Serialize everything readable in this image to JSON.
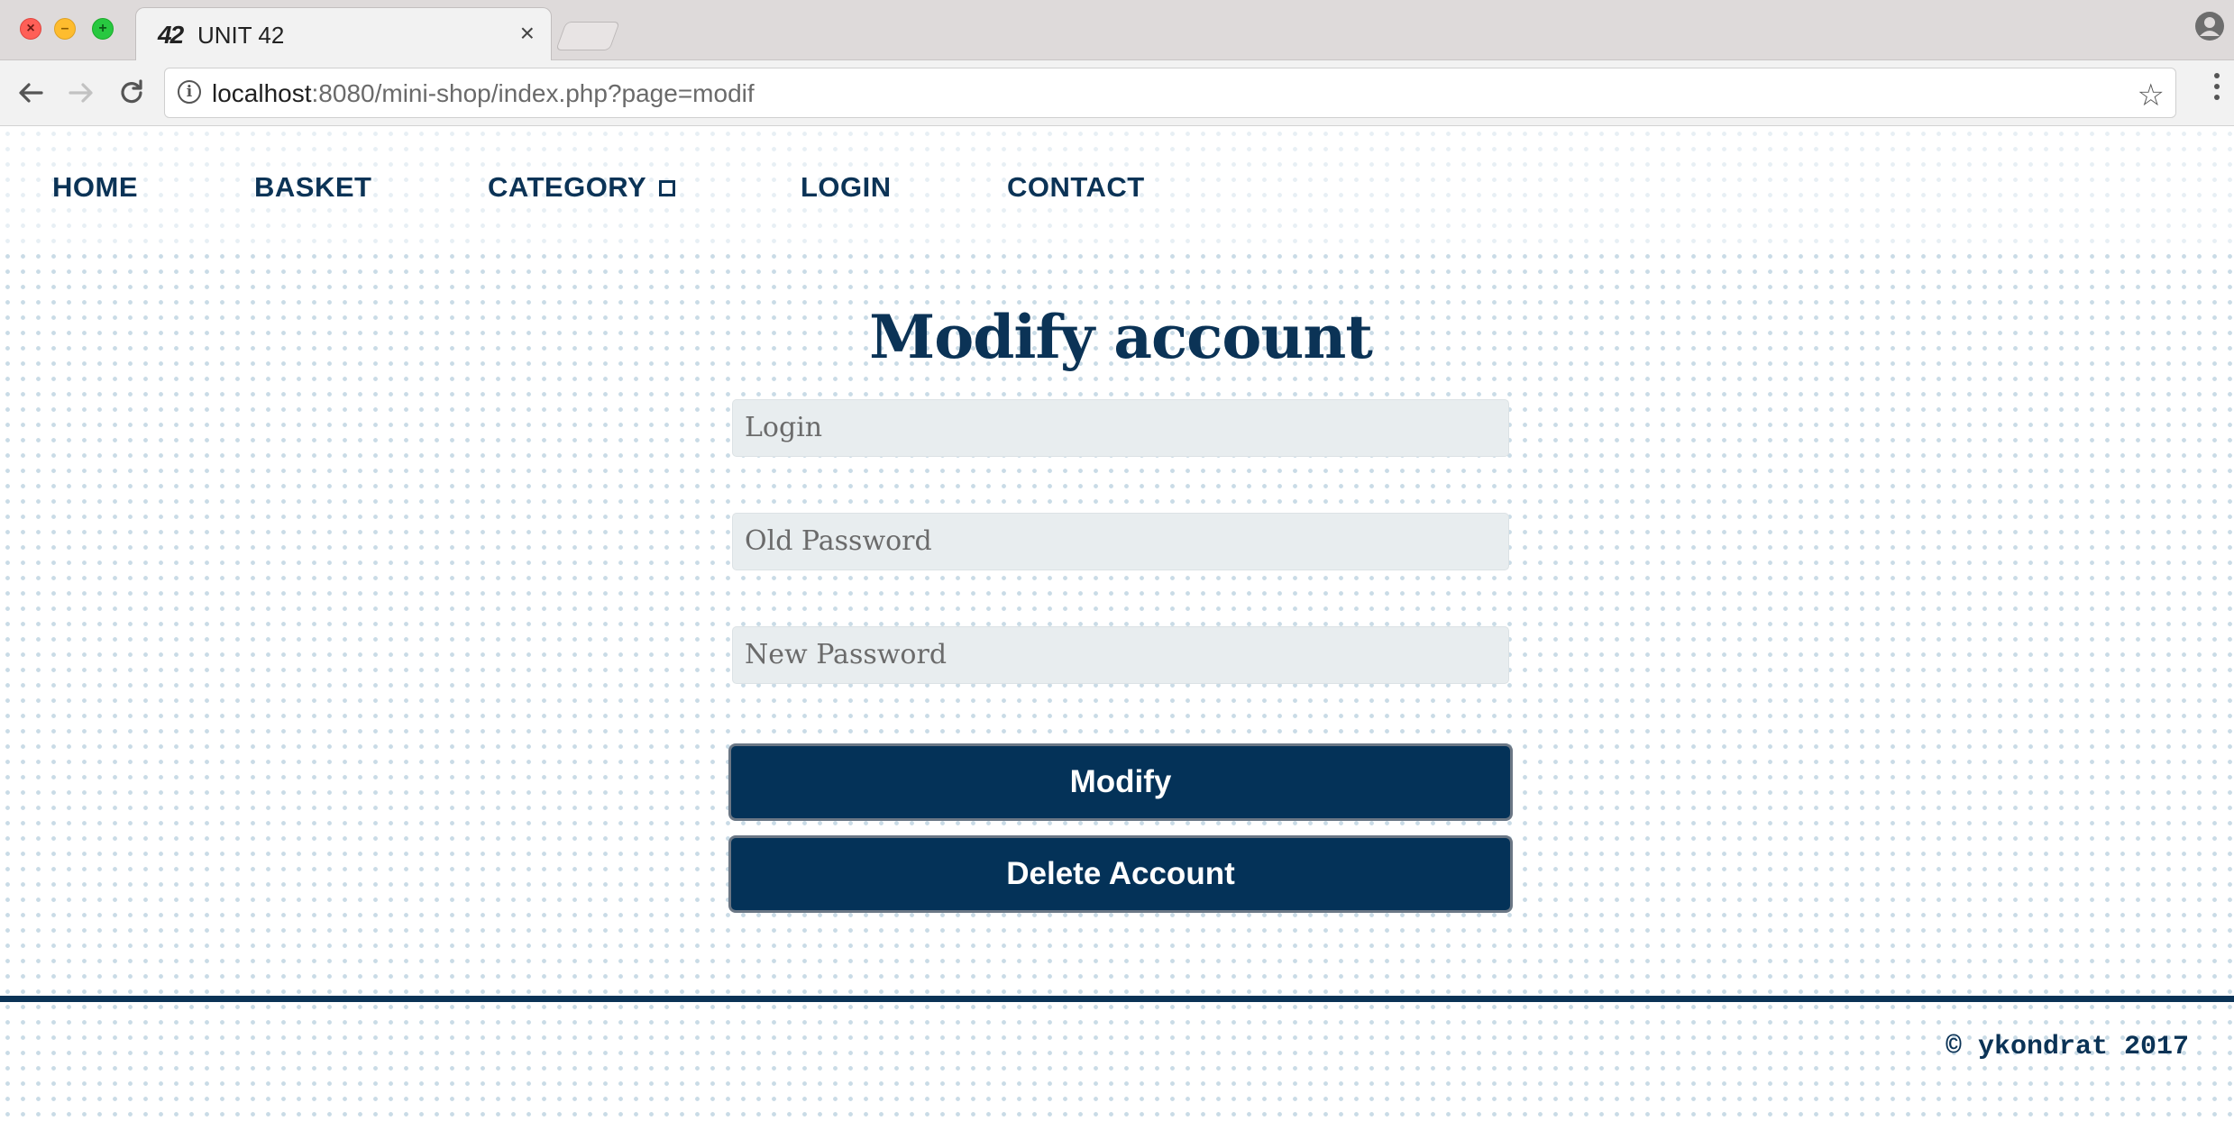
{
  "browser": {
    "tab_title": "UNIT 42",
    "tab_logo": "42",
    "url_host": "localhost",
    "url_rest": ":8080/mini-shop/index.php?page=modif",
    "icons": [
      "close-icon",
      "minimize-icon",
      "maximize-icon",
      "tab-close-icon",
      "back-icon",
      "forward-icon",
      "reload-icon",
      "info-icon",
      "star-icon",
      "menu-icon",
      "profile-icon"
    ]
  },
  "nav": {
    "items": [
      {
        "label": "HOME"
      },
      {
        "label": "BASKET"
      },
      {
        "label": "CATEGORY"
      },
      {
        "label": "LOGIN"
      },
      {
        "label": "CONTACT"
      }
    ]
  },
  "form": {
    "title": "Modify account",
    "login_placeholder": "Login",
    "old_password_placeholder": "Old Password",
    "new_password_placeholder": "New Password",
    "modify_label": "Modify",
    "delete_label": "Delete Account"
  },
  "footer": {
    "copyright": "© ykondrat 2017"
  },
  "colors": {
    "brand": "#0b3356",
    "button": "#043258",
    "input_bg": "#e8edef",
    "dots": "#c9dbe6"
  }
}
